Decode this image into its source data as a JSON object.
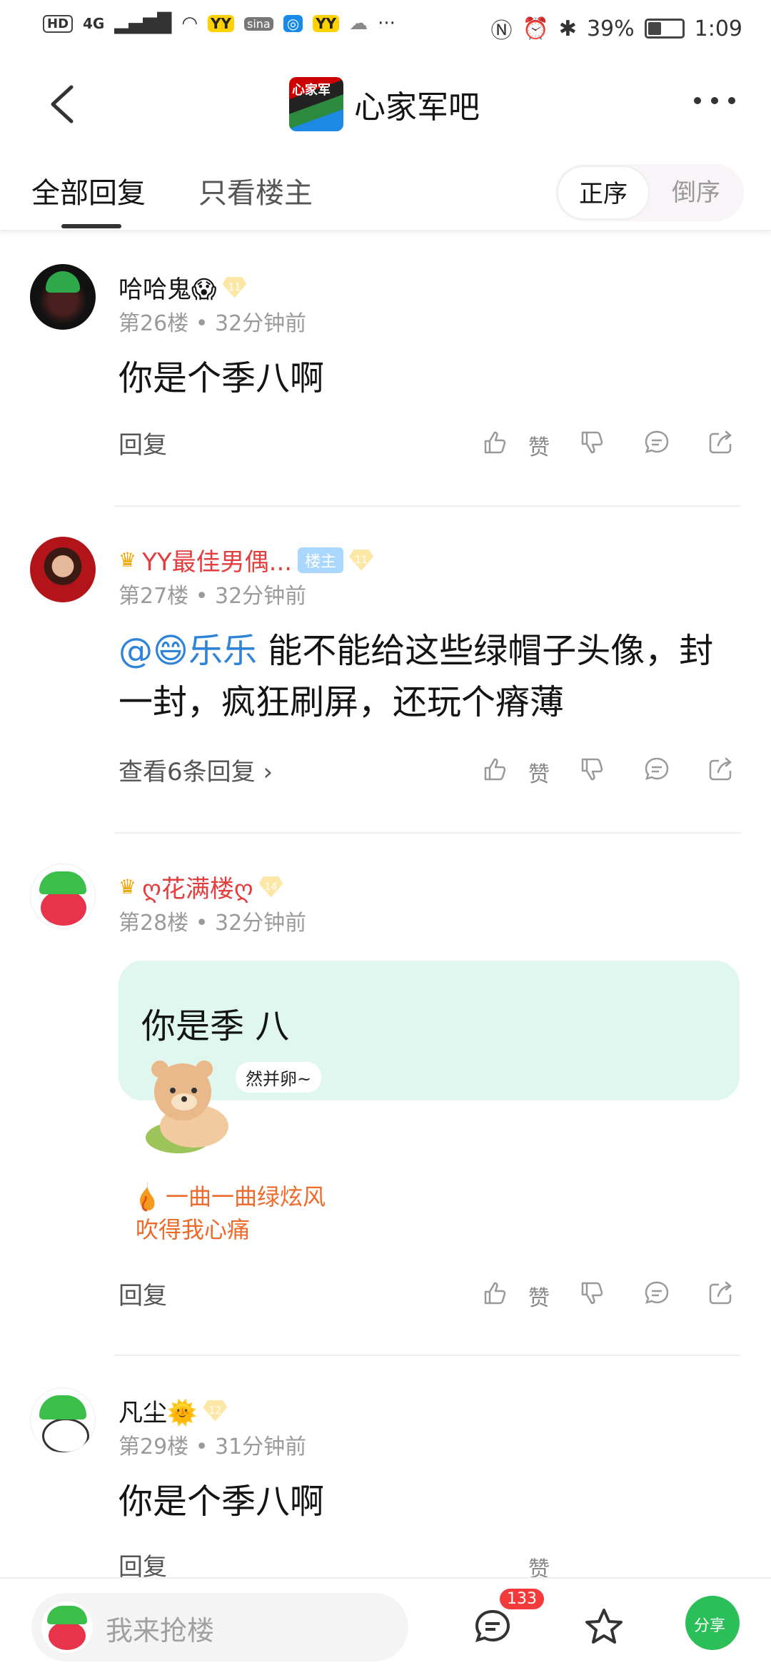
{
  "status_bar": {
    "hd": "HD",
    "net": "4G",
    "battery_pct": "39%",
    "battery_level": 0.39,
    "time": "1:09",
    "more": "···"
  },
  "nav": {
    "logo_text": "心家军",
    "forum_name": "心家军吧"
  },
  "tabs": {
    "all_replies": "全部回复",
    "only_host": "只看楼主",
    "sort_asc": "正序",
    "sort_desc": "倒序"
  },
  "posts": [
    {
      "username": "哈哈鬼😱",
      "level": "11",
      "floor": "第26楼",
      "time": "32分钟前",
      "content": "你是个季八啊",
      "action": "回复",
      "like_label": "赞"
    },
    {
      "username": "YY最佳男偶...",
      "host_tag": "楼主",
      "level": "11",
      "floor": "第27楼",
      "time": "32分钟前",
      "mention": "@😄乐乐",
      "content": " 能不能给这些绿帽子头像，封一封，疯狂刷屏，还玩个瘠薄",
      "action": "查看6条回复 ›",
      "like_label": "赞"
    },
    {
      "username": "ღ花满楼ღ",
      "level": "14",
      "floor": "第28楼",
      "time": "32分钟前",
      "content": "你是季 八",
      "sticker_caption": "然并卵~",
      "signature_line1": "一曲一曲绿炫风",
      "signature_line2": "吹得我心痛",
      "action": "回复",
      "like_label": "赞"
    },
    {
      "username": "凡尘🌞",
      "level": "12",
      "floor": "第29楼",
      "time": "31分钟前",
      "content": "你是个季八啊",
      "action": "回复",
      "like_label": "赞"
    }
  ],
  "bottom_bar": {
    "input_placeholder": "我来抢楼",
    "comment_count": "133",
    "wechat_label": "分享"
  },
  "meta_dot": "•"
}
